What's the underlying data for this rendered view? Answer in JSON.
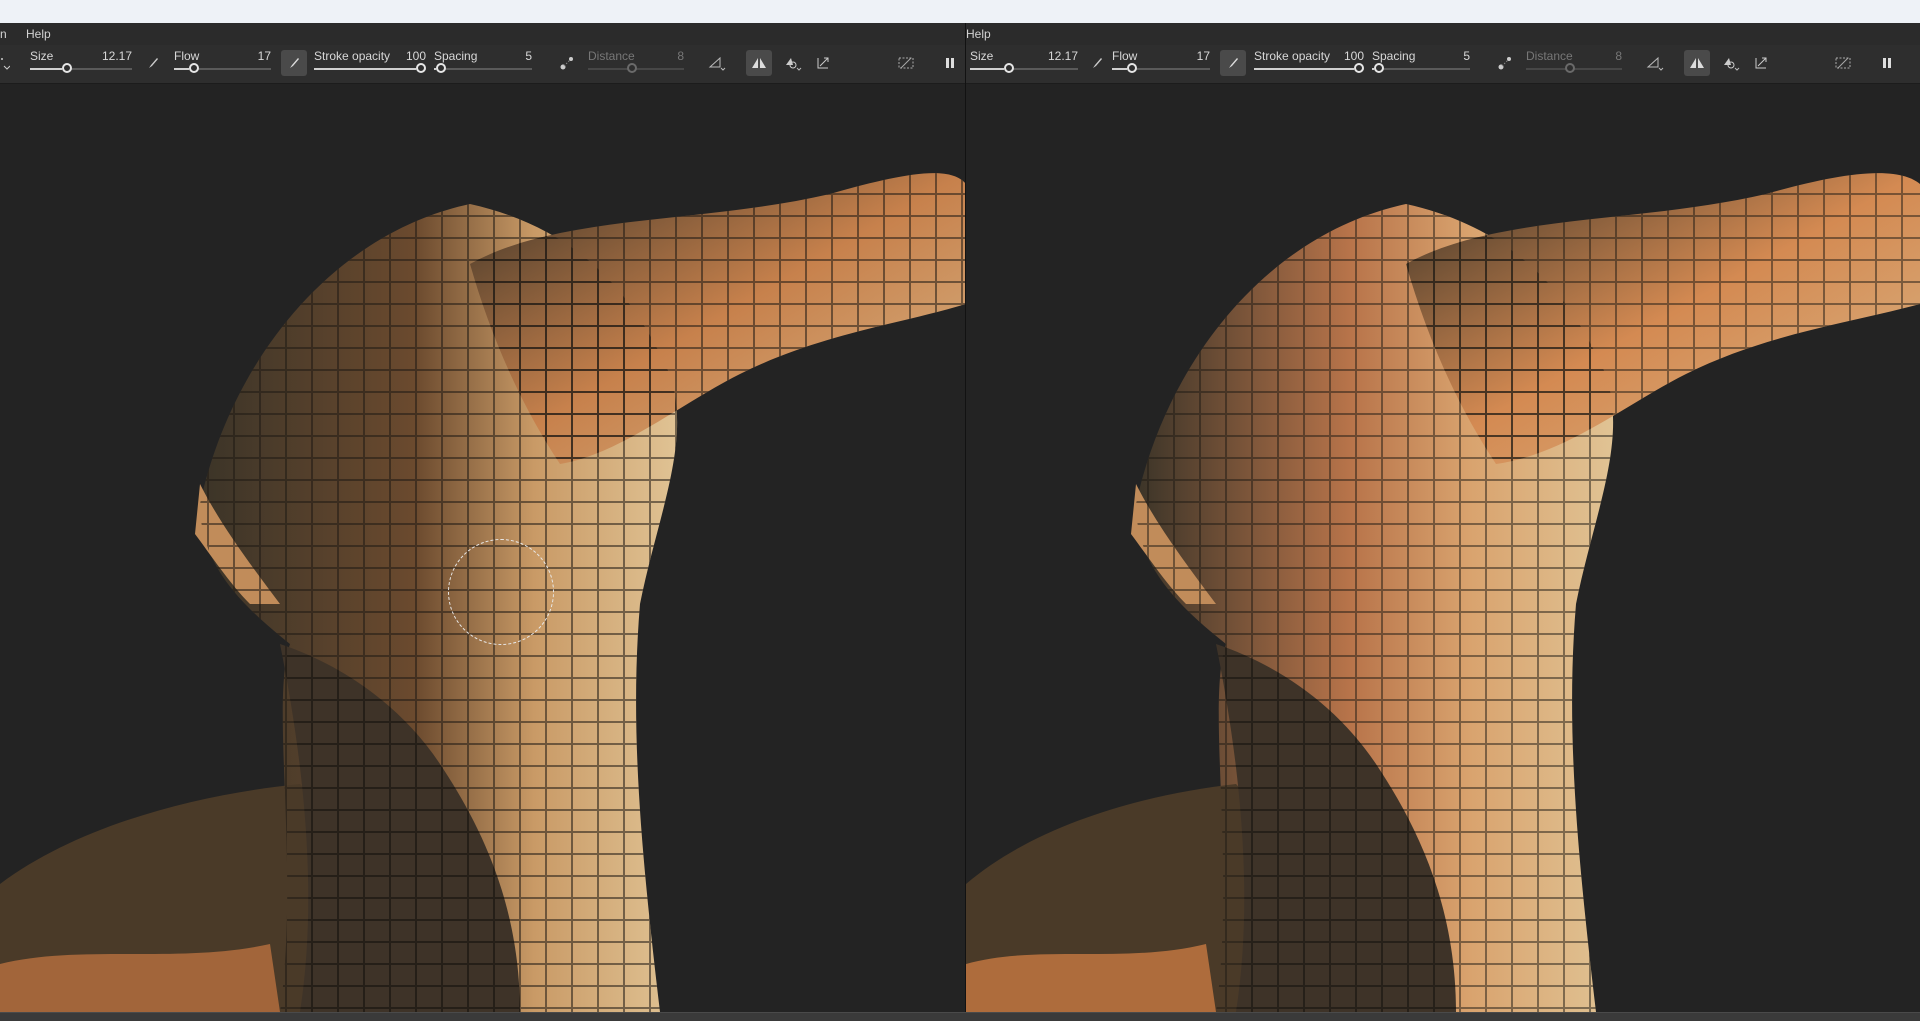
{
  "menu": {
    "left_partial": "n",
    "help": "Help"
  },
  "toolbar": {
    "size_label": "Size",
    "size_value": "12.17",
    "size_fraction": 0.35,
    "flow_label": "Flow",
    "flow_value": "17",
    "flow_fraction": 0.17,
    "stroke_opacity_label": "Stroke opacity",
    "stroke_opacity_value": "100",
    "stroke_opacity_fraction": 1.0,
    "spacing_label": "Spacing",
    "spacing_value": "5",
    "spacing_fraction": 0.02,
    "distance_label": "Distance",
    "distance_value": "8",
    "distance_fraction": 0.45
  },
  "icons": {
    "brush": "brush-icon",
    "symmetry": "symmetry-icon",
    "lazy_mouse": "lazy-mouse-icon",
    "pen_pressure": "pen-pressure-icon",
    "mirror": "mirror-icon",
    "stencil": "stencil-icon",
    "transform": "transform-icon",
    "hide_overlay": "hide-overlay-icon",
    "pause": "pause-icon"
  },
  "colors": {
    "panel_bg": "#2e2e2e",
    "viewport_bg": "#232323",
    "skin_light": "#d9b98a",
    "skin_orange": "#d48a52",
    "skin_dark": "#3b3428"
  }
}
